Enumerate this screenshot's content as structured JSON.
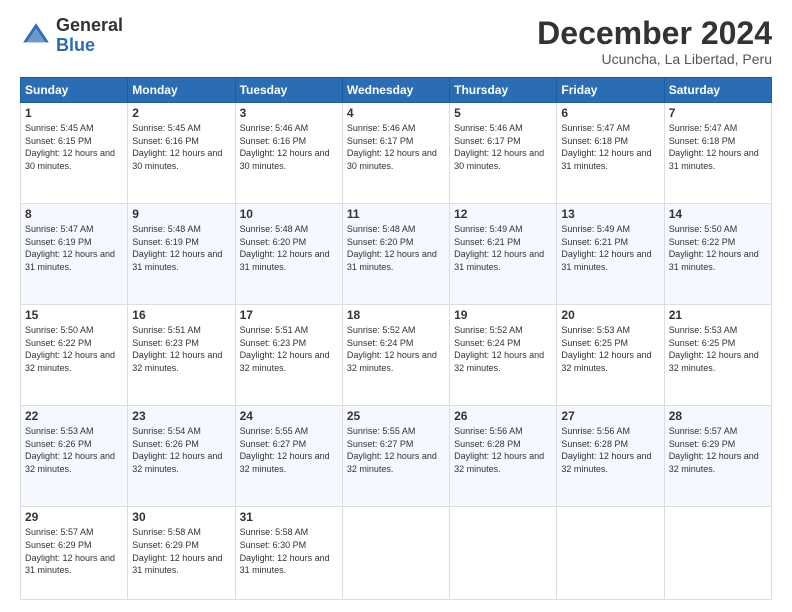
{
  "logo": {
    "general": "General",
    "blue": "Blue"
  },
  "header": {
    "month_year": "December 2024",
    "location": "Ucuncha, La Libertad, Peru"
  },
  "days_of_week": [
    "Sunday",
    "Monday",
    "Tuesday",
    "Wednesday",
    "Thursday",
    "Friday",
    "Saturday"
  ],
  "weeks": [
    [
      {
        "day": "1",
        "sunrise": "5:45 AM",
        "sunset": "6:15 PM",
        "daylight": "12 hours and 30 minutes."
      },
      {
        "day": "2",
        "sunrise": "5:45 AM",
        "sunset": "6:16 PM",
        "daylight": "12 hours and 30 minutes."
      },
      {
        "day": "3",
        "sunrise": "5:46 AM",
        "sunset": "6:16 PM",
        "daylight": "12 hours and 30 minutes."
      },
      {
        "day": "4",
        "sunrise": "5:46 AM",
        "sunset": "6:17 PM",
        "daylight": "12 hours and 30 minutes."
      },
      {
        "day": "5",
        "sunrise": "5:46 AM",
        "sunset": "6:17 PM",
        "daylight": "12 hours and 30 minutes."
      },
      {
        "day": "6",
        "sunrise": "5:47 AM",
        "sunset": "6:18 PM",
        "daylight": "12 hours and 31 minutes."
      },
      {
        "day": "7",
        "sunrise": "5:47 AM",
        "sunset": "6:18 PM",
        "daylight": "12 hours and 31 minutes."
      }
    ],
    [
      {
        "day": "8",
        "sunrise": "5:47 AM",
        "sunset": "6:19 PM",
        "daylight": "12 hours and 31 minutes."
      },
      {
        "day": "9",
        "sunrise": "5:48 AM",
        "sunset": "6:19 PM",
        "daylight": "12 hours and 31 minutes."
      },
      {
        "day": "10",
        "sunrise": "5:48 AM",
        "sunset": "6:20 PM",
        "daylight": "12 hours and 31 minutes."
      },
      {
        "day": "11",
        "sunrise": "5:48 AM",
        "sunset": "6:20 PM",
        "daylight": "12 hours and 31 minutes."
      },
      {
        "day": "12",
        "sunrise": "5:49 AM",
        "sunset": "6:21 PM",
        "daylight": "12 hours and 31 minutes."
      },
      {
        "day": "13",
        "sunrise": "5:49 AM",
        "sunset": "6:21 PM",
        "daylight": "12 hours and 31 minutes."
      },
      {
        "day": "14",
        "sunrise": "5:50 AM",
        "sunset": "6:22 PM",
        "daylight": "12 hours and 31 minutes."
      }
    ],
    [
      {
        "day": "15",
        "sunrise": "5:50 AM",
        "sunset": "6:22 PM",
        "daylight": "12 hours and 32 minutes."
      },
      {
        "day": "16",
        "sunrise": "5:51 AM",
        "sunset": "6:23 PM",
        "daylight": "12 hours and 32 minutes."
      },
      {
        "day": "17",
        "sunrise": "5:51 AM",
        "sunset": "6:23 PM",
        "daylight": "12 hours and 32 minutes."
      },
      {
        "day": "18",
        "sunrise": "5:52 AM",
        "sunset": "6:24 PM",
        "daylight": "12 hours and 32 minutes."
      },
      {
        "day": "19",
        "sunrise": "5:52 AM",
        "sunset": "6:24 PM",
        "daylight": "12 hours and 32 minutes."
      },
      {
        "day": "20",
        "sunrise": "5:53 AM",
        "sunset": "6:25 PM",
        "daylight": "12 hours and 32 minutes."
      },
      {
        "day": "21",
        "sunrise": "5:53 AM",
        "sunset": "6:25 PM",
        "daylight": "12 hours and 32 minutes."
      }
    ],
    [
      {
        "day": "22",
        "sunrise": "5:53 AM",
        "sunset": "6:26 PM",
        "daylight": "12 hours and 32 minutes."
      },
      {
        "day": "23",
        "sunrise": "5:54 AM",
        "sunset": "6:26 PM",
        "daylight": "12 hours and 32 minutes."
      },
      {
        "day": "24",
        "sunrise": "5:55 AM",
        "sunset": "6:27 PM",
        "daylight": "12 hours and 32 minutes."
      },
      {
        "day": "25",
        "sunrise": "5:55 AM",
        "sunset": "6:27 PM",
        "daylight": "12 hours and 32 minutes."
      },
      {
        "day": "26",
        "sunrise": "5:56 AM",
        "sunset": "6:28 PM",
        "daylight": "12 hours and 32 minutes."
      },
      {
        "day": "27",
        "sunrise": "5:56 AM",
        "sunset": "6:28 PM",
        "daylight": "12 hours and 32 minutes."
      },
      {
        "day": "28",
        "sunrise": "5:57 AM",
        "sunset": "6:29 PM",
        "daylight": "12 hours and 32 minutes."
      }
    ],
    [
      {
        "day": "29",
        "sunrise": "5:57 AM",
        "sunset": "6:29 PM",
        "daylight": "12 hours and 31 minutes."
      },
      {
        "day": "30",
        "sunrise": "5:58 AM",
        "sunset": "6:29 PM",
        "daylight": "12 hours and 31 minutes."
      },
      {
        "day": "31",
        "sunrise": "5:58 AM",
        "sunset": "6:30 PM",
        "daylight": "12 hours and 31 minutes."
      },
      null,
      null,
      null,
      null
    ]
  ],
  "labels": {
    "sunrise_prefix": "Sunrise: ",
    "sunset_prefix": "Sunset: ",
    "daylight_prefix": "Daylight: "
  }
}
